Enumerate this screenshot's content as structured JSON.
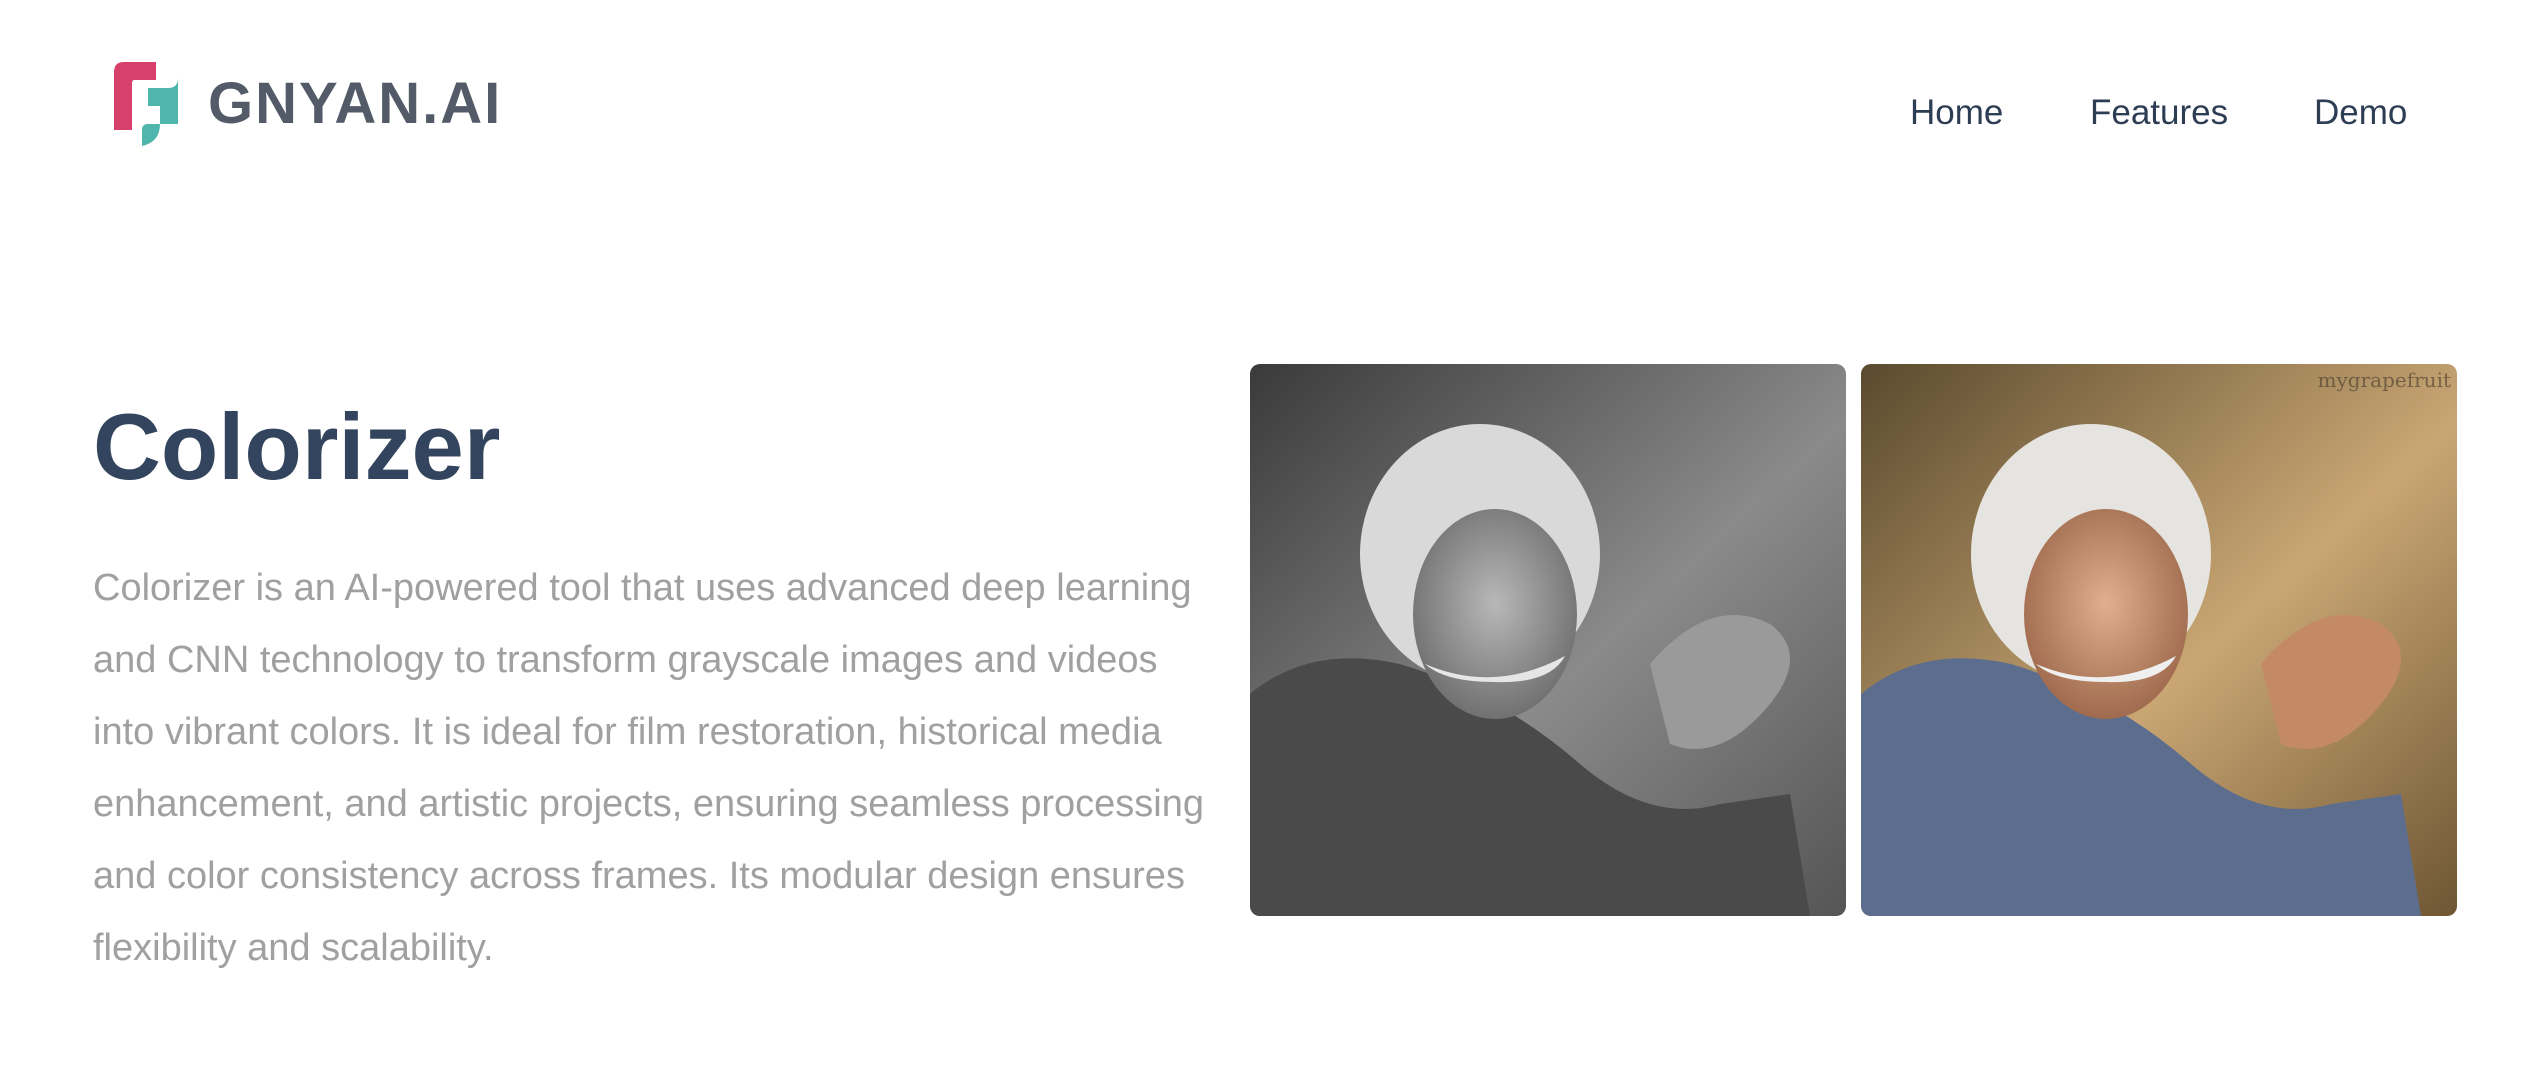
{
  "brand": {
    "name": "GNYAN.AI",
    "mark_colors": [
      "#d6406a",
      "#4fb6ad"
    ]
  },
  "nav": {
    "items": [
      {
        "label": "Home"
      },
      {
        "label": "Features"
      },
      {
        "label": "Demo"
      }
    ],
    "color": "#2d3d53"
  },
  "hero": {
    "title": "Colorizer",
    "description": "Colorizer is an AI-powered tool that uses advanced deep learning and CNN technology to transform grayscale images and videos into vibrant colors. It is ideal for film restoration, historical media enhancement, and artistic projects, ensuring seamless processing and color consistency across frames. Its modular design ensures flexibility and scalability."
  },
  "comparison": {
    "before_label": "grayscale portrait",
    "after_label": "colorized portrait",
    "watermark": "mygrapefruit"
  },
  "colors": {
    "title": "#33455e",
    "body_text": "#a0a0a0",
    "background": "#ffffff"
  }
}
